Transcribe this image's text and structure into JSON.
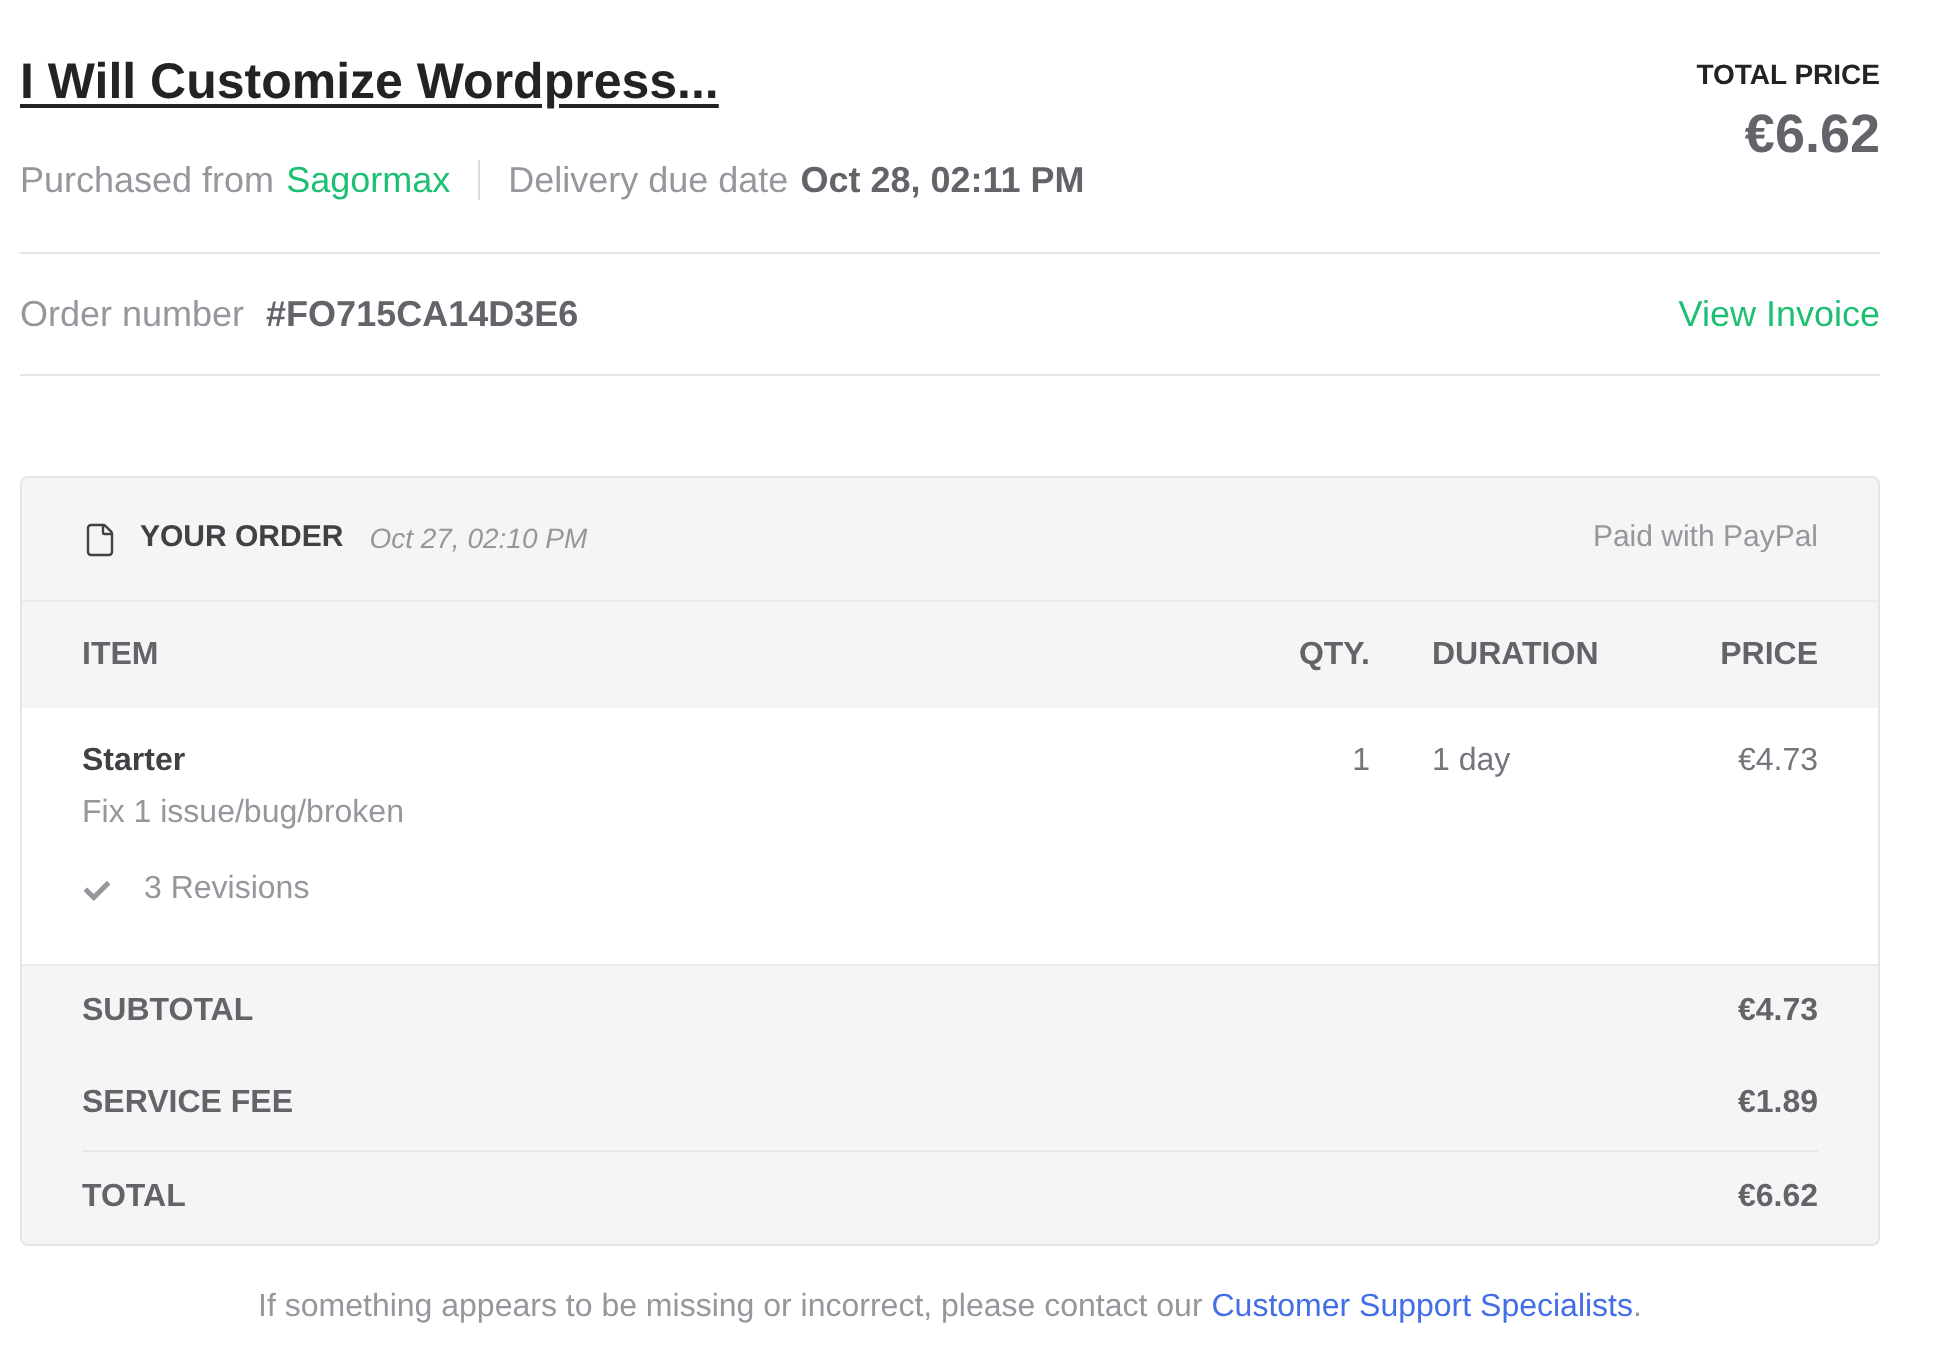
{
  "order": {
    "title": "I Will Customize Wordpress...",
    "purchased_from_label": "Purchased from",
    "seller": "Sagormax",
    "delivery_label": "Delivery due date",
    "delivery_date": "Oct 28, 02:11 PM",
    "total_price_label": "TOTAL PRICE",
    "total_price": "€6.62",
    "order_number_label": "Order number",
    "order_number": "#FO715CA14D3E6",
    "invoice_link": "View Invoice"
  },
  "summary_card": {
    "heading": "YOUR ORDER",
    "date": "Oct 27, 02:10 PM",
    "payment": "Paid with PayPal",
    "columns": [
      "ITEM",
      "QTY.",
      "DURATION",
      "PRICE"
    ],
    "items": [
      {
        "name": "Starter",
        "description": "Fix 1 issue/bug/broken",
        "features": [
          "3 Revisions"
        ],
        "qty": "1",
        "duration": "1 day",
        "price": "€4.73"
      }
    ],
    "totals": [
      {
        "label": "SUBTOTAL",
        "amount": "€4.73"
      },
      {
        "label": "SERVICE FEE",
        "amount": "€1.89"
      },
      {
        "label": "TOTAL",
        "amount": "€6.62"
      }
    ]
  },
  "footer": {
    "text_before": "If something appears to be missing or incorrect, please contact our",
    "link": "Customer Support Specialists",
    "text_after": "."
  }
}
